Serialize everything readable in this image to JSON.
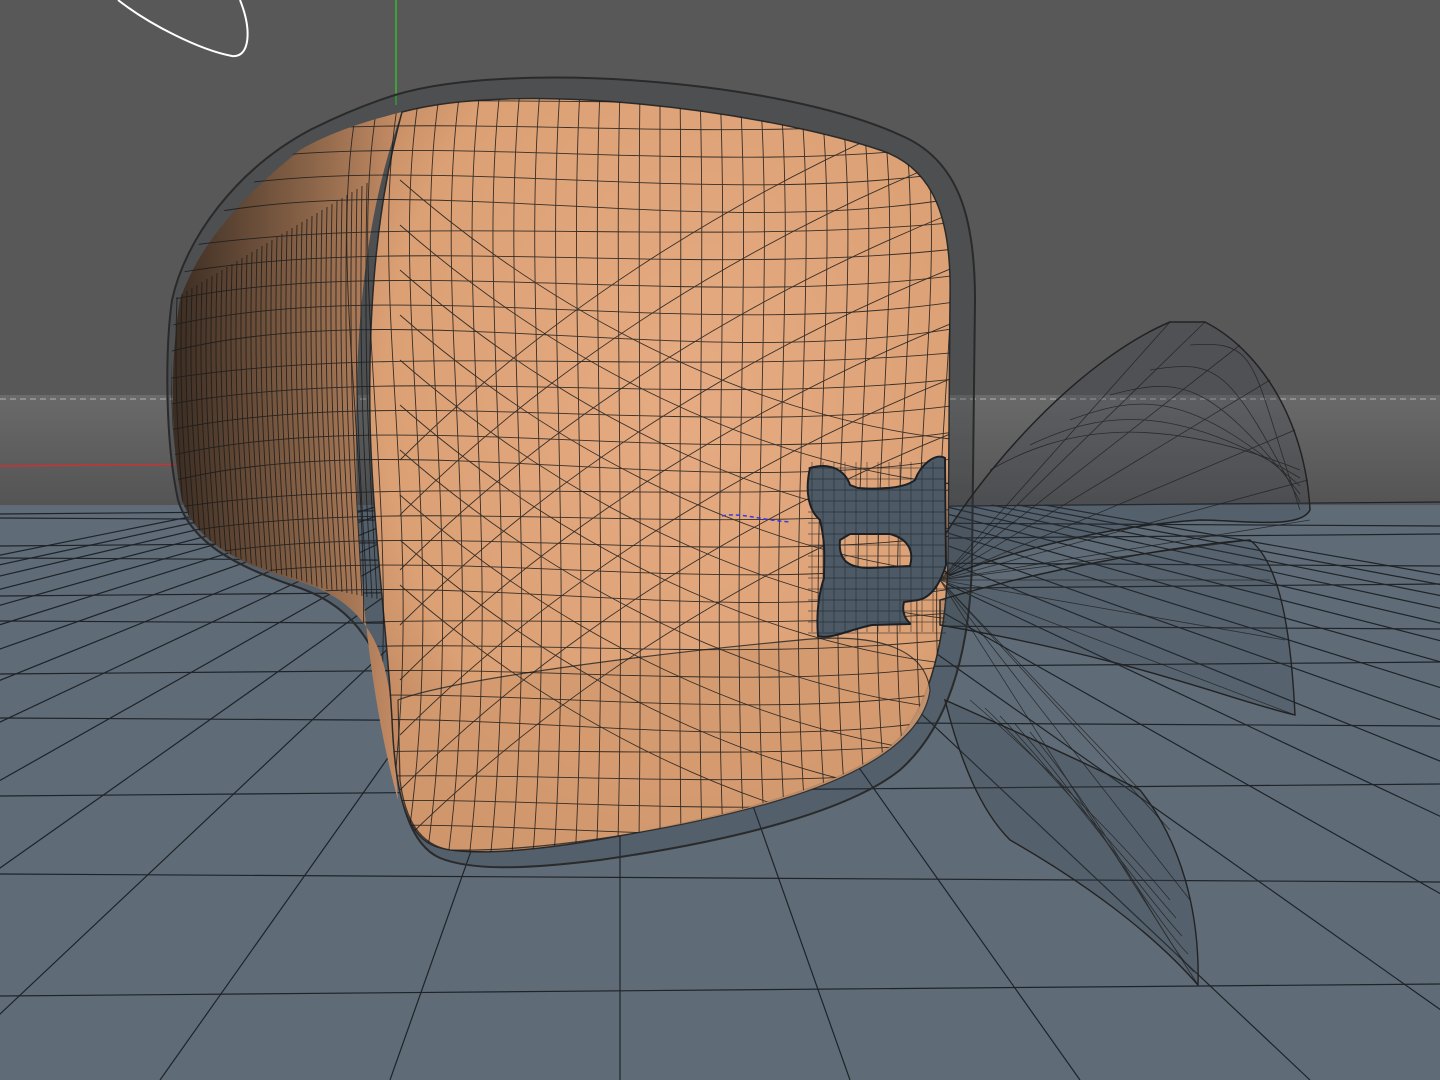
{
  "viewport": {
    "mode": "perspective",
    "display": "shaded-wireframe"
  },
  "colors": {
    "sky": "#585858",
    "floor": "#5f6c78",
    "floor_grid": "#1e2328",
    "horizon_glow": "#7a7a7a",
    "skin": "#e2a57a",
    "skin_shadow": "#b97f5a",
    "cage_line": "#1a1a1a",
    "strap": "#4d5a66",
    "strap_line": "#1b2026",
    "axis_x": "#d03030",
    "axis_y": "#30c030",
    "spline": "#ffffff",
    "pivot": "#3a3ae0"
  },
  "icons": {
    "world_axis_x": "axis-x-icon",
    "world_axis_y": "axis-y-icon",
    "spline_curve": "spline-curve-icon",
    "object_pivot": "pivot-icon"
  }
}
